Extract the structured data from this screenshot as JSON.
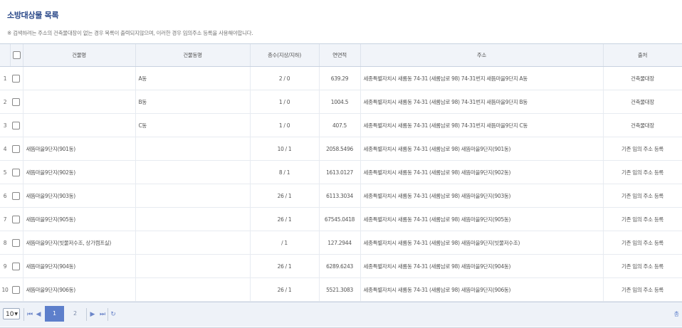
{
  "page": {
    "title": "소방대상물 목록",
    "notice": "※ 검색하려는 주소의 건축물대장이 없는 경우 목록이 출력되지않으며, 이러한 경우 임의주소 등록을 사용해야합니다."
  },
  "table": {
    "columns": [
      "건물명",
      "건물동명",
      "층수(지상/지하)",
      "연면적",
      "주소",
      "출처"
    ],
    "rows": [
      {
        "no": "1",
        "name": "",
        "dong": "A동",
        "floors": "2 / 0",
        "area": "639.29",
        "address": "세종특별자치시 새롬동 74-31 (새롬남로 98) 74-31번지 새뜸마을9단지 A동",
        "source": "건축물대장"
      },
      {
        "no": "2",
        "name": "",
        "dong": "B동",
        "floors": "1 / 0",
        "area": "1004.5",
        "address": "세종특별자치시 새롬동 74-31 (새롬남로 98) 74-31번지 새뜸마을9단지 B동",
        "source": "건축물대장"
      },
      {
        "no": "3",
        "name": "",
        "dong": "C동",
        "floors": "1 / 0",
        "area": "407.5",
        "address": "세종특별자치시 새롬동 74-31 (새롬남로 98) 74-31번지 새뜸마을9단지 C동",
        "source": "건축물대장"
      },
      {
        "no": "4",
        "name": "새뜸마을9단지(901동)",
        "dong": "",
        "floors": "10 / 1",
        "area": "2058.5496",
        "address": "세종특별자치시 새롬동 74-31 (새롬남로 98) 새뜸마을9단지(901동)",
        "source": "기존 임의 주소 등록"
      },
      {
        "no": "5",
        "name": "새뜸마을9단지(902동)",
        "dong": "",
        "floors": "8 / 1",
        "area": "1613.0127",
        "address": "세종특별자치시 새롬동 74-31 (새롬남로 98) 새뜸마을9단지(902동)",
        "source": "기존 임의 주소 등록"
      },
      {
        "no": "6",
        "name": "새뜸마을9단지(903동)",
        "dong": "",
        "floors": "26 / 1",
        "area": "6113.3034",
        "address": "세종특별자치시 새롬동 74-31 (새롬남로 98) 새뜸마을9단지(903동)",
        "source": "기존 임의 주소 등록"
      },
      {
        "no": "7",
        "name": "새뜸마을9단지(905동)",
        "dong": "",
        "floors": "26 / 1",
        "area": "67545.0418",
        "address": "세종특별자치시 새롬동 74-31 (새롬남로 98) 새뜸마을9단지(905동)",
        "source": "기존 임의 주소 등록"
      },
      {
        "no": "8",
        "name": "새뜸마을9단지(빗물저수조, 상가캠프실)",
        "dong": "",
        "floors": "/ 1",
        "area": "127.2944",
        "address": "세종특별자치시 새롬동 74-31 (새롬남로 98) 새뜸마을9단지(빗물저수조)",
        "source": "기존 임의 주소 등록"
      },
      {
        "no": "9",
        "name": "새뜸마을9단지(904동)",
        "dong": "",
        "floors": "26 / 1",
        "area": "6289.6243",
        "address": "세종특별자치시 새롬동 74-31 (새롬남로 98) 새뜸마을9단지(904동)",
        "source": "기존 임의 주소 등록"
      },
      {
        "no": "10",
        "name": "새뜸마을9단지(906동)",
        "dong": "",
        "floors": "26 / 1",
        "area": "5521.3083",
        "address": "세종특별자치시 새롬동 74-31 (새롬남로 98) 새뜸마을9단지(906동)",
        "source": "기존 임의 주소 등록"
      }
    ]
  },
  "pager": {
    "page_size": "10",
    "pages": [
      "1",
      "2"
    ],
    "active_page": "1",
    "info": "총",
    "icons": [
      "first-page-icon",
      "prev-page-icon",
      "next-page-icon",
      "last-page-icon",
      "refresh-icon"
    ]
  },
  "colors": {
    "title": "#2c4a8a",
    "accent": "#5d7fcb",
    "header_bg": "#f1f4f9",
    "pager_bg": "#eef2f8"
  }
}
